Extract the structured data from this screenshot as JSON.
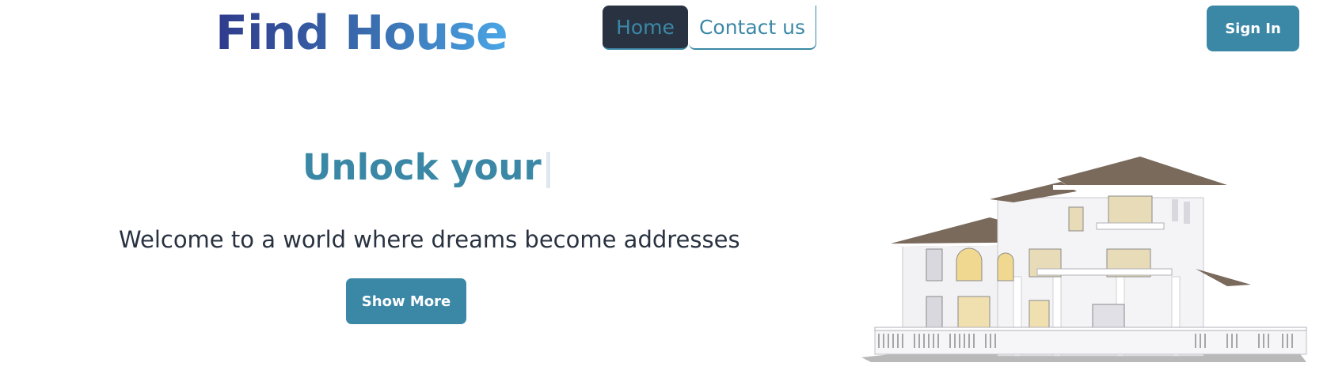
{
  "header": {
    "logo": "Find House",
    "nav": [
      {
        "label": "Home",
        "active": true
      },
      {
        "label": "Contact us",
        "active": false
      }
    ],
    "signin_label": "Sign In"
  },
  "hero": {
    "headline": "Unlock your",
    "subtitle": "Welcome to a world where dreams become addresses",
    "button_label": "Show More",
    "image_icon": "house-illustration"
  },
  "colors": {
    "accent": "#3b88a6",
    "dark": "#293241",
    "logo_gradient_start": "#2f3b8c",
    "logo_gradient_end": "#4aa6e6"
  }
}
